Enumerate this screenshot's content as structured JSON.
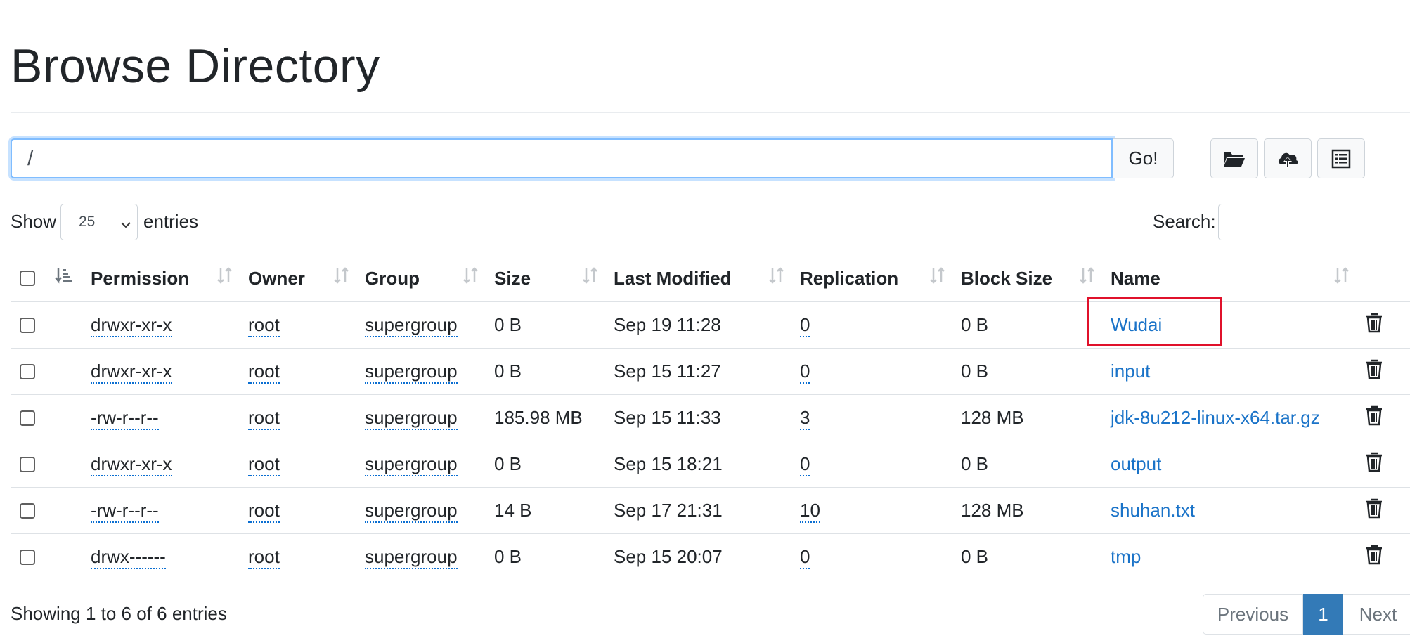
{
  "page": {
    "title": "Browse Directory"
  },
  "toolbar": {
    "path_value": "/",
    "go_label": "Go!",
    "buttons": [
      {
        "icon": "folder-open-icon",
        "name": "create-directory-button"
      },
      {
        "icon": "cloud-upload-icon",
        "name": "upload-files-button"
      },
      {
        "icon": "list-icon",
        "name": "cut-paste-button"
      }
    ]
  },
  "controls": {
    "show_label": "Show",
    "page_length": "25",
    "entries_label": "entries",
    "search_label": "Search:",
    "search_value": ""
  },
  "table": {
    "columns": [
      "Permission",
      "Owner",
      "Group",
      "Size",
      "Last Modified",
      "Replication",
      "Block Size",
      "Name"
    ],
    "rows": [
      {
        "permission": "drwxr-xr-x",
        "owner": "root",
        "group": "supergroup",
        "size": "0 B",
        "modified": "Sep 19 11:28",
        "replication": "0",
        "block_size": "0 B",
        "name": "Wudai"
      },
      {
        "permission": "drwxr-xr-x",
        "owner": "root",
        "group": "supergroup",
        "size": "0 B",
        "modified": "Sep 15 11:27",
        "replication": "0",
        "block_size": "0 B",
        "name": "input"
      },
      {
        "permission": "-rw-r--r--",
        "owner": "root",
        "group": "supergroup",
        "size": "185.98 MB",
        "modified": "Sep 15 11:33",
        "replication": "3",
        "block_size": "128 MB",
        "name": "jdk-8u212-linux-x64.tar.gz"
      },
      {
        "permission": "drwxr-xr-x",
        "owner": "root",
        "group": "supergroup",
        "size": "0 B",
        "modified": "Sep 15 18:21",
        "replication": "0",
        "block_size": "0 B",
        "name": "output"
      },
      {
        "permission": "-rw-r--r--",
        "owner": "root",
        "group": "supergroup",
        "size": "14 B",
        "modified": "Sep 17 21:31",
        "replication": "10",
        "block_size": "128 MB",
        "name": "shuhan.txt"
      },
      {
        "permission": "drwx------",
        "owner": "root",
        "group": "supergroup",
        "size": "0 B",
        "modified": "Sep 15 20:07",
        "replication": "0",
        "block_size": "0 B",
        "name": "tmp"
      }
    ]
  },
  "footer": {
    "info": "Showing 1 to 6 of 6 entries",
    "previous_label": "Previous",
    "current_page": "1",
    "next_label": "Next"
  },
  "colors": {
    "link": "#1a73c8",
    "active_page": "#337ab7",
    "highlight_border": "#e0112b",
    "focus_border": "#80bdff"
  }
}
